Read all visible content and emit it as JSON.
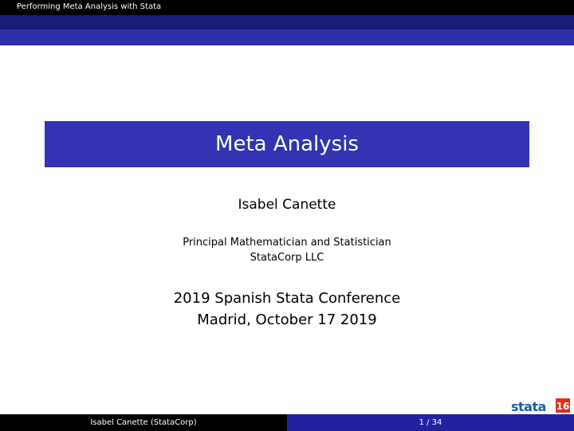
{
  "header": {
    "short_title": "Performing Meta Analysis with Stata"
  },
  "title": "Meta Analysis",
  "author": "Isabel Canette",
  "institute": {
    "line1": "Principal Mathematician and Statistician",
    "line2": "StataCorp LLC"
  },
  "event": {
    "line1": "2019 Spanish Stata Conference",
    "line2": "Madrid, October 17 2019"
  },
  "logo": {
    "text": "stata",
    "version": "16"
  },
  "footer": {
    "author_institute": "Isabel Canette  (StataCorp)",
    "page": "1 / 34"
  },
  "colors": {
    "header_bg": "#000000",
    "title_box": "#3333b3",
    "footer_right": "#2222a0",
    "logo_blue": "#1a5dad",
    "logo_red": "#e03020"
  }
}
